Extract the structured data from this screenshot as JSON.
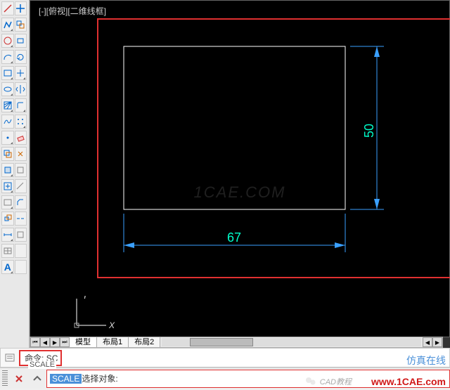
{
  "view_label": "[-][俯视][二维线框]",
  "tabs": {
    "model": "模型",
    "layout1": "布局1",
    "layout2": "布局2"
  },
  "ucs": {
    "x": "X",
    "y": "Y"
  },
  "drawing": {
    "width_dim": "67",
    "height_dim": "50"
  },
  "watermark": "1CAE.COM",
  "command": {
    "prefix": "命令:",
    "typed": "SC",
    "resolved": "SCALE",
    "prompt_cmd": "SCALE",
    "prompt_tail": " 选择对象:"
  },
  "branding": {
    "name": "仿真在线",
    "url": "www.1CAE.com",
    "small": "CAD教程"
  }
}
